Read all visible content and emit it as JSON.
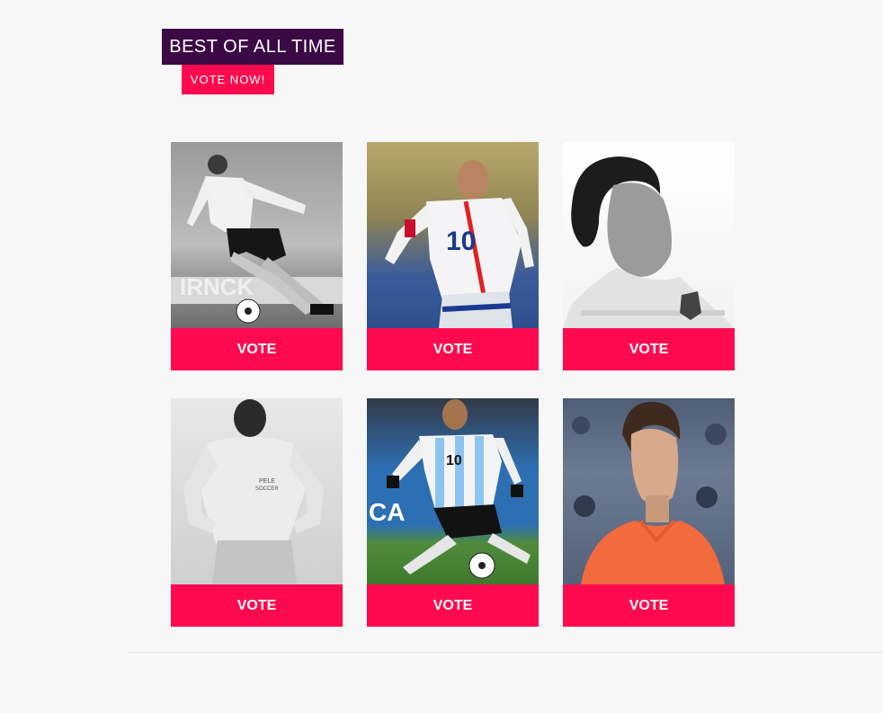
{
  "header": {
    "title": "BEST OF ALL TIME",
    "vote_now_label": "VOTE NOW!"
  },
  "colors": {
    "title_bg": "#3b0a45",
    "accent": "#ff0a4f",
    "page_bg": "#f7f7f7"
  },
  "cards": [
    {
      "vote_label": "VOTE",
      "photo": "player-photo-bw-kicking-ball"
    },
    {
      "vote_label": "VOTE",
      "photo": "player-photo-france-number-10"
    },
    {
      "vote_label": "VOTE",
      "photo": "player-photo-bw-argentina-portrait"
    },
    {
      "vote_label": "VOTE",
      "photo": "player-photo-bw-pele-soccer-shirt"
    },
    {
      "vote_label": "VOTE",
      "photo": "player-photo-argentina-number-10"
    },
    {
      "vote_label": "VOTE",
      "photo": "player-photo-orange-shirt"
    }
  ]
}
